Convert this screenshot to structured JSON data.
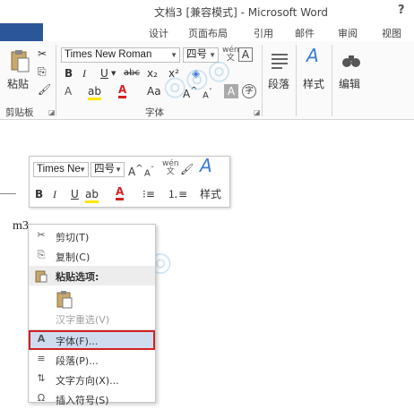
{
  "window": {
    "title": "文档3 [兼容模式] - Microsoft Word",
    "help": "?"
  },
  "tabs": [
    "设计",
    "页面布局",
    "引用",
    "邮件",
    "审阅",
    "视图"
  ],
  "ribbon": {
    "clipboard": {
      "paste_label": "粘贴",
      "group_label": "剪贴板"
    },
    "font": {
      "font_name": "Times New Roman",
      "font_size": "四号",
      "bold": "B",
      "italic": "I",
      "underline": "U",
      "strikethrough": "abc",
      "subscript": "x₂",
      "superscript": "x²",
      "font_color_glyph": "A",
      "change_case": "Aa",
      "group_label": "字体"
    },
    "paragraph": {
      "label": "段落"
    },
    "styles": {
      "label": "样式"
    },
    "editing": {
      "label": "编辑"
    }
  },
  "document": {
    "text": "m3"
  },
  "mini_toolbar": {
    "font_name": "Times Ne",
    "font_size": "四号",
    "bold": "B",
    "italic": "I",
    "underline": "U",
    "font_color_glyph": "A",
    "styles_label": "样式"
  },
  "context_menu": {
    "items": [
      {
        "label": "剪切(T)",
        "icon": "cut-icon",
        "disabled": false
      },
      {
        "label": "复制(C)",
        "icon": "copy-icon",
        "disabled": false
      },
      {
        "label": "粘贴选项:",
        "icon": "paste-icon",
        "disabled": false,
        "header": true
      },
      {
        "label": "",
        "icon": "paste-keep-text-icon",
        "disabled": false
      },
      {
        "label": "汉字重选(V)",
        "icon": "",
        "disabled": true
      },
      {
        "label": "字体(F)...",
        "icon": "font-icon",
        "disabled": false,
        "highlighted": true
      },
      {
        "label": "段落(P)...",
        "icon": "paragraph-icon",
        "disabled": false
      },
      {
        "label": "文字方向(X)...",
        "icon": "text-direction-icon",
        "disabled": false
      },
      {
        "label": "插入符号(S)",
        "icon": "symbol-icon",
        "disabled": false
      }
    ]
  },
  "colors": {
    "accent": "#2b579a",
    "highlight": "#cfdcf0",
    "highlight_border": "#d42020",
    "font_red": "#d42020",
    "highlighter_yellow": "#ffe600"
  }
}
